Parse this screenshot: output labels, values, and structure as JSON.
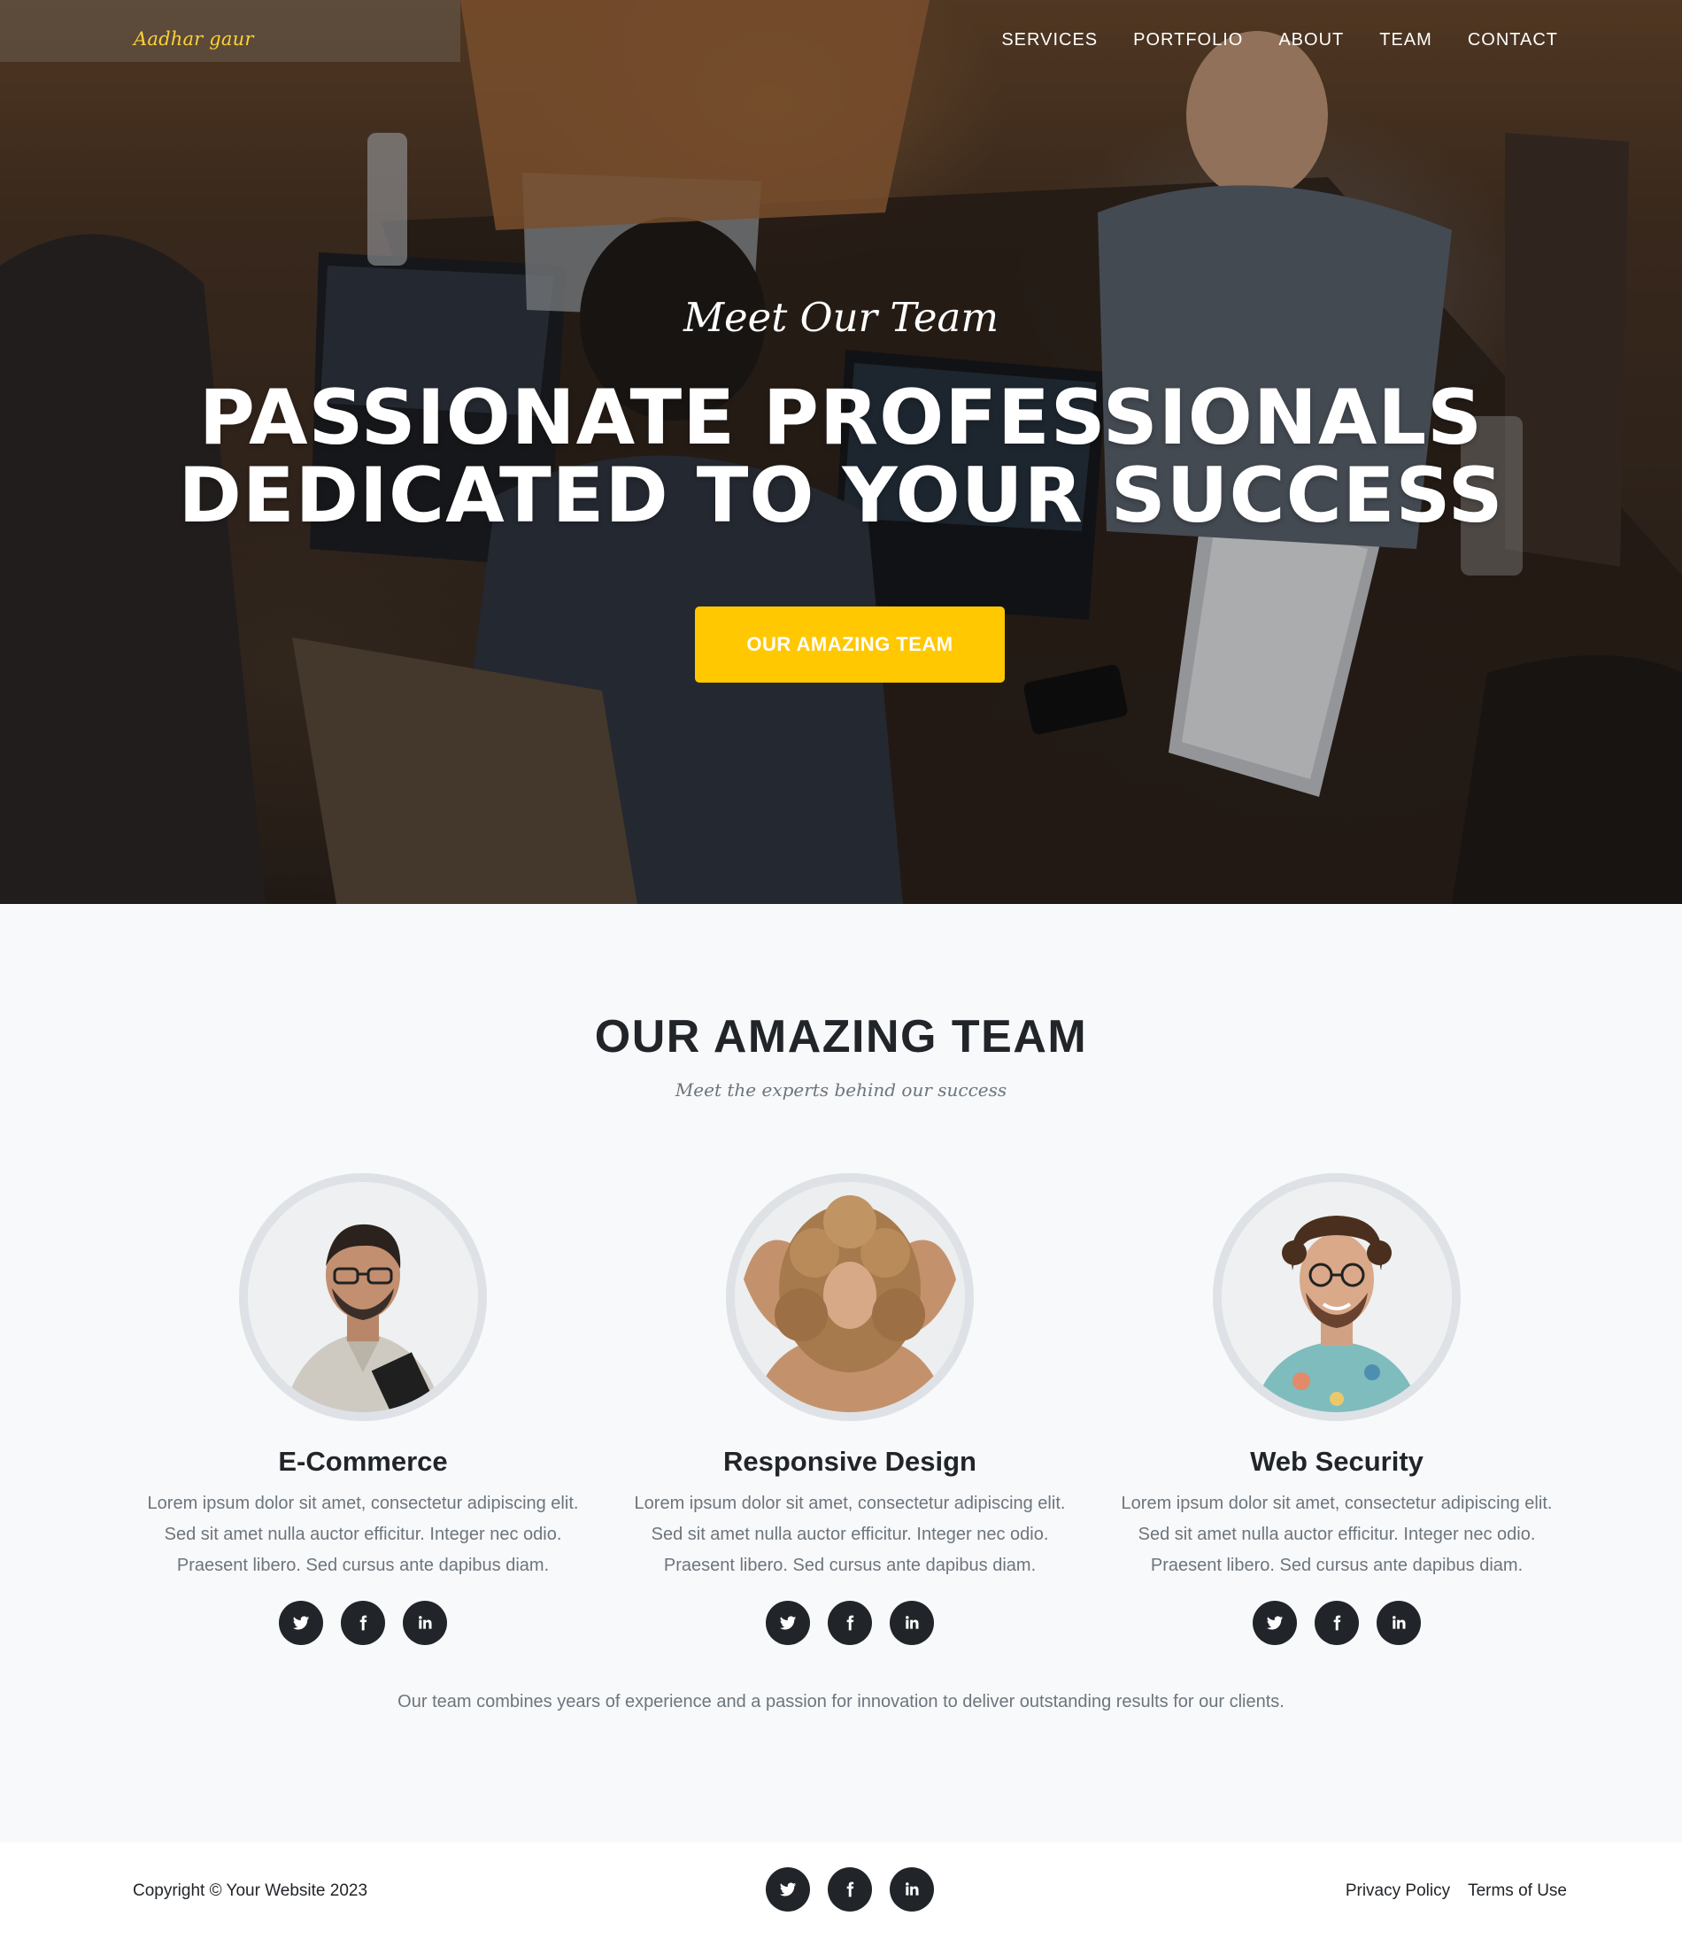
{
  "nav": {
    "brand": "Aadhar gaur",
    "links": [
      "SERVICES",
      "PORTFOLIO",
      "ABOUT",
      "TEAM",
      "CONTACT"
    ]
  },
  "hero": {
    "subheading": "Meet Our Team",
    "heading_line1": "PASSIONATE PROFESSIONALS",
    "heading_line2": "DEDICATED TO YOUR SUCCESS",
    "button": "OUR AMAZING TEAM"
  },
  "team": {
    "heading": "OUR AMAZING TEAM",
    "subheading": "Meet the experts behind our success",
    "members": [
      {
        "name": "E-Commerce",
        "desc_line1": "Lorem ipsum dolor sit amet, consectetur adipiscing elit.",
        "desc_line2": "Sed sit amet nulla auctor efficitur. Integer nec odio.",
        "desc_line3": "Praesent libero. Sed cursus ante dapibus diam."
      },
      {
        "name": "Responsive Design",
        "desc_line1": "Lorem ipsum dolor sit amet, consectetur adipiscing elit.",
        "desc_line2": "Sed sit amet nulla auctor efficitur. Integer nec odio.",
        "desc_line3": "Praesent libero. Sed cursus ante dapibus diam."
      },
      {
        "name": "Web Security",
        "desc_line1": "Lorem ipsum dolor sit amet, consectetur adipiscing elit.",
        "desc_line2": "Sed sit amet nulla auctor efficitur. Integer nec odio.",
        "desc_line3": "Praesent libero. Sed cursus ante dapibus diam."
      }
    ],
    "note": "Our team combines years of experience and a passion for innovation to deliver outstanding results for our clients.",
    "social_icons": [
      "twitter-icon",
      "facebook-icon",
      "linkedin-icon"
    ]
  },
  "footer": {
    "copyright": "Copyright © Your Website 2023",
    "links": [
      "Privacy Policy",
      "Terms of Use"
    ]
  },
  "colors": {
    "accent": "#ffc800",
    "brand": "#fed136",
    "dark": "#212529",
    "muted": "#6c757d",
    "section_bg": "#f8f9fa"
  }
}
